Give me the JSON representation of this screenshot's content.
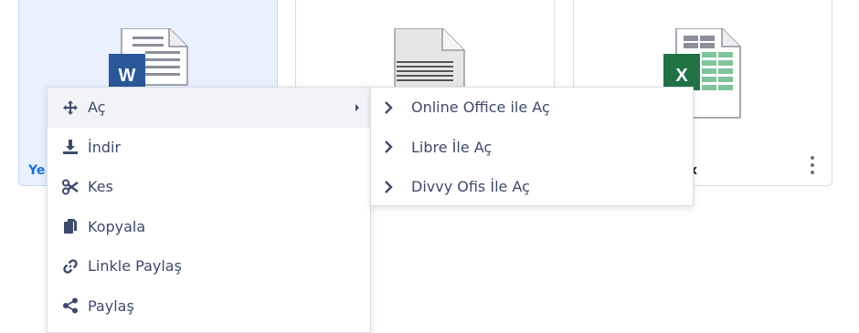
{
  "cards": [
    {
      "name": "Ye",
      "type": "word",
      "selected": true
    },
    {
      "name": "",
      "type": "text",
      "selected": false
    },
    {
      "name": "x",
      "type": "excel",
      "selected": false
    }
  ],
  "context_menu": {
    "items": [
      {
        "label": "Aç",
        "icon": "move-icon",
        "has_submenu": true
      },
      {
        "label": "İndir",
        "icon": "download-icon"
      },
      {
        "label": "Kes",
        "icon": "scissors-icon"
      },
      {
        "label": "Kopyala",
        "icon": "copy-icon"
      },
      {
        "label": "Linkle Paylaş",
        "icon": "link-icon"
      },
      {
        "label": "Paylaş",
        "icon": "share-icon"
      }
    ]
  },
  "submenu": {
    "items": [
      {
        "label": "Online Office ile Aç",
        "icon": "chevron-right-icon"
      },
      {
        "label": "Libre İle Aç",
        "icon": "chevron-right-icon"
      },
      {
        "label": "Divvy Ofis İle Aç",
        "icon": "chevron-right-icon"
      }
    ]
  },
  "colors": {
    "accent": "#1a73d9",
    "word": "#2b579a",
    "excel": "#217346",
    "menu_text": "#3d4a6b"
  }
}
